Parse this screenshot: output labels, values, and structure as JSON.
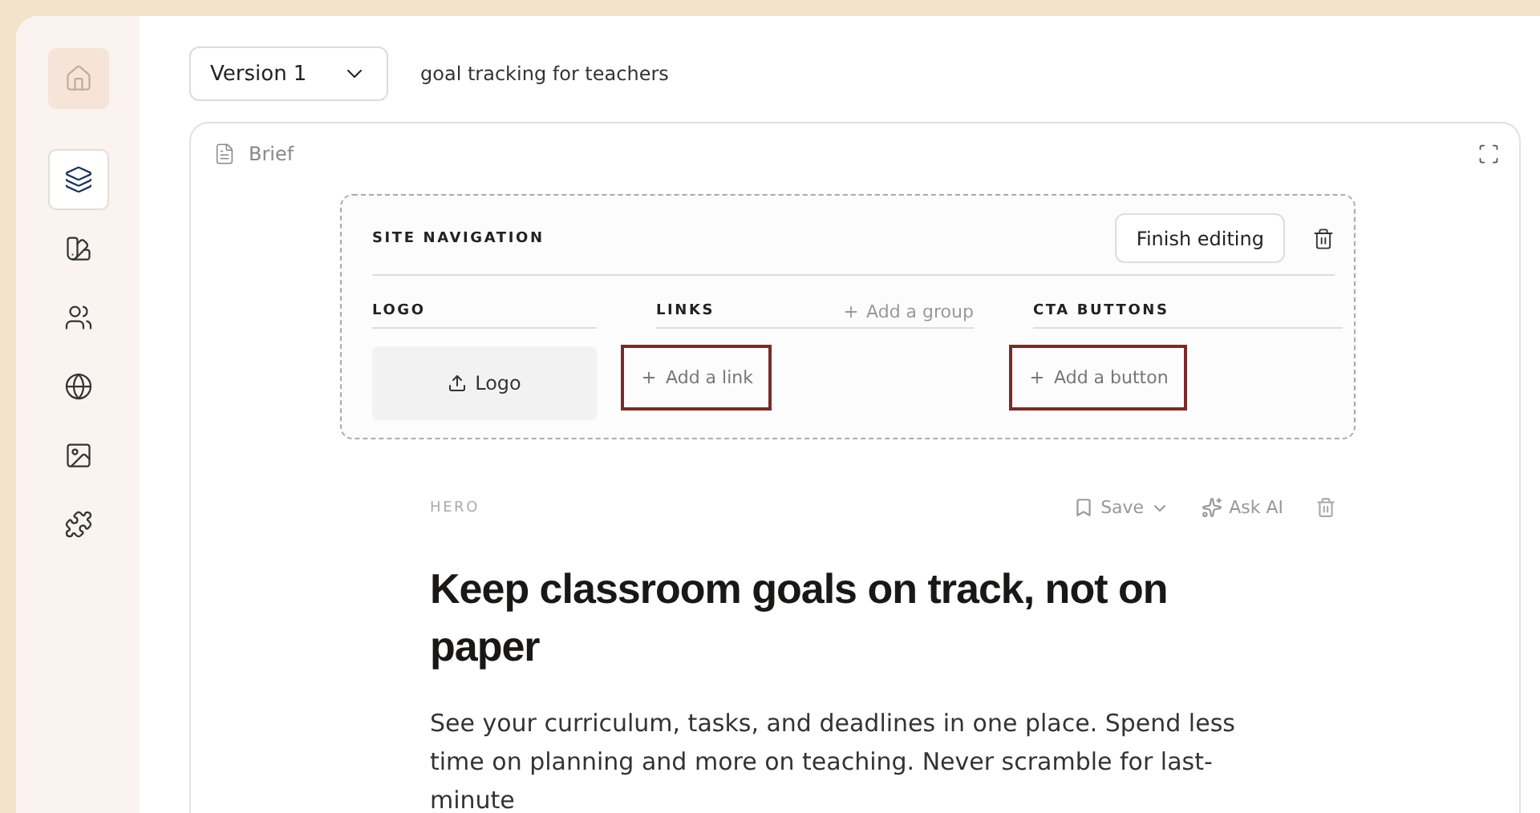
{
  "sidebar": {
    "items": [
      {
        "kind": "home",
        "selected": false
      },
      {
        "kind": "layers",
        "selected": true
      },
      {
        "kind": "swatch",
        "selected": false
      },
      {
        "kind": "users",
        "selected": false
      },
      {
        "kind": "globe",
        "selected": false
      },
      {
        "kind": "image",
        "selected": false
      },
      {
        "kind": "puzzle",
        "selected": false
      }
    ]
  },
  "toolbar": {
    "version": "Version 1",
    "project": "goal tracking for teachers"
  },
  "card": {
    "title": "Brief",
    "navigation": {
      "title": "SITE NAVIGATION",
      "finish": "Finish editing",
      "logo": {
        "header": "LOGO",
        "button": "Logo"
      },
      "links": {
        "header": "LINKS",
        "add_group": "Add a group",
        "add": "Add a link",
        "highlighted": true
      },
      "cta": {
        "header": "CTA BUTTONS",
        "add": "Add a button",
        "highlighted": true
      }
    },
    "hero": {
      "label": "HERO",
      "save": "Save",
      "ask": "Ask AI",
      "heading": "Keep classroom goals on track, not on paper",
      "body": "See your curriculum, tasks, and deadlines in one place. Spend less time on planning and more on teaching. Never scramble for last-minute"
    }
  }
}
